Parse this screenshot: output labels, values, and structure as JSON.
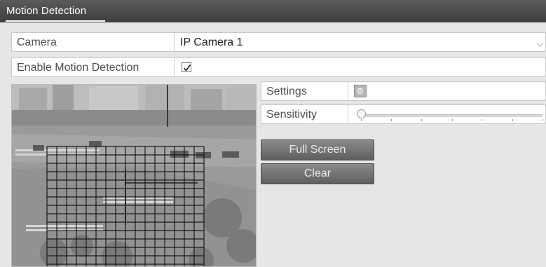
{
  "header": {
    "title": "Motion Detection"
  },
  "camera": {
    "label": "Camera",
    "value": "IP Camera 1"
  },
  "enable": {
    "label": "Enable Motion Detection",
    "checked": true
  },
  "settings": {
    "label": "Settings",
    "icon": "gear-icon"
  },
  "sensitivity": {
    "label": "Sensitivity",
    "level": 0
  },
  "buttons": {
    "full_screen": "Full Screen",
    "clear": "Clear"
  },
  "preview": {
    "content": "live camera image of a street intersection with motion detection grid overlay"
  },
  "colors": {
    "titlebar": "#4a4a4a",
    "background": "#e6e6e6",
    "button": "#707070"
  }
}
